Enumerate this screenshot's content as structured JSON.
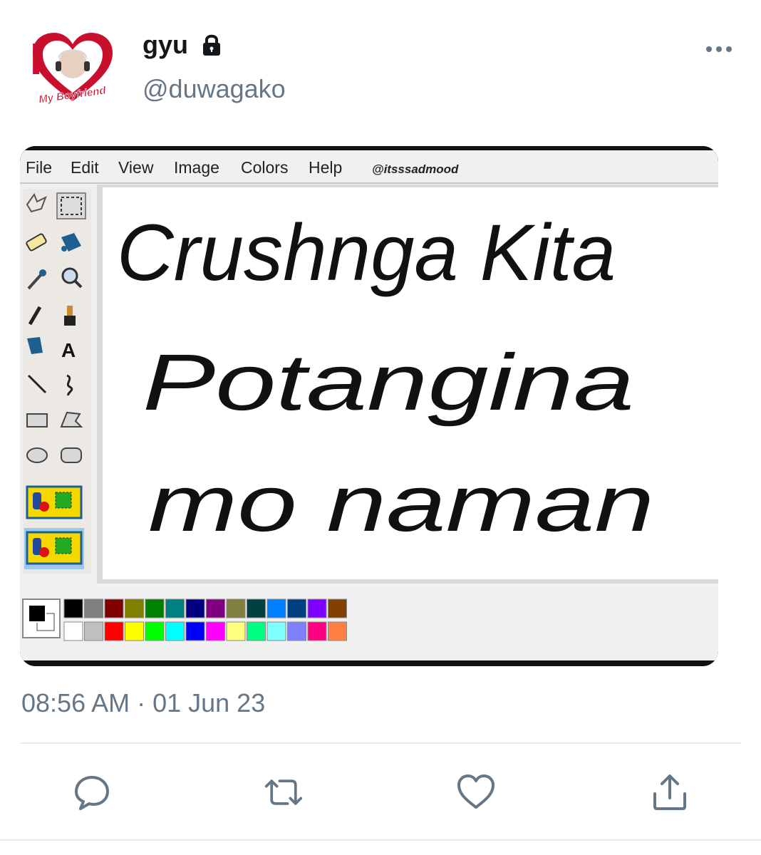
{
  "tweet": {
    "display_name": "gyu",
    "handle": "@duwagako",
    "timestamp": "08:56 AM · 01 Jun 23",
    "avatar": {
      "big_letter": "I",
      "caption": "My Boyfriend"
    }
  },
  "paint": {
    "menu": [
      "File",
      "Edit",
      "View",
      "Image",
      "Colors",
      "Help"
    ],
    "watermark": "@itsssadmood",
    "handwritten_lines": [
      "Crushnga Kita",
      "Potangina",
      "mo naman"
    ],
    "palette_top": [
      "#000000",
      "#808080",
      "#800000",
      "#808000",
      "#008000",
      "#008080",
      "#000080",
      "#800080",
      "#808040",
      "#004040",
      "#0080ff",
      "#004080",
      "#8000ff",
      "#804000"
    ],
    "palette_bottom": [
      "#ffffff",
      "#c0c0c0",
      "#ff0000",
      "#ffff00",
      "#00ff00",
      "#00ffff",
      "#0000ff",
      "#ff00ff",
      "#ffff80",
      "#00ff80",
      "#80ffff",
      "#8080ff",
      "#ff0080",
      "#ff8040"
    ]
  },
  "actions": [
    "reply-icon",
    "retweet-icon",
    "like-icon",
    "share-icon"
  ],
  "colors": {
    "text": "#14171a",
    "secondary": "#657786",
    "icon": "#1da1f2"
  }
}
